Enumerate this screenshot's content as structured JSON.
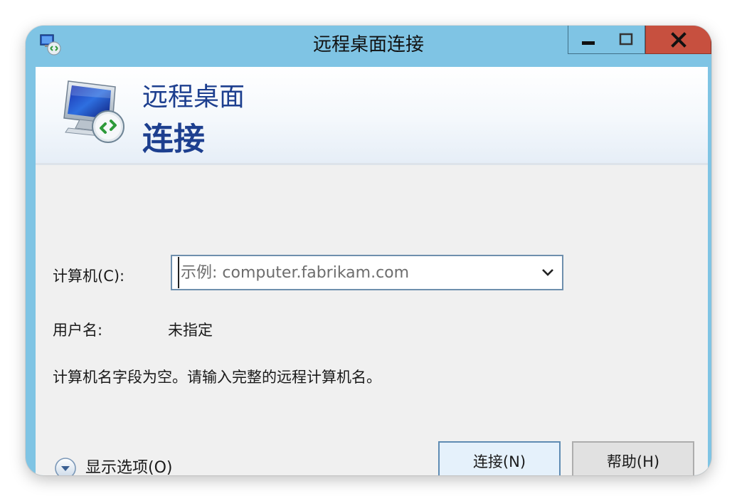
{
  "window": {
    "title": "远程桌面连接",
    "app_icon": "remote-desktop-icon",
    "controls": {
      "minimize_icon": "minimize-icon",
      "maximize_icon": "maximize-icon",
      "close_icon": "close-icon",
      "close_color": "#c7503f"
    },
    "titlebar_color": "#7fc4e4"
  },
  "banner": {
    "line1": "远程桌面",
    "line2": "连接",
    "icon": "remote-desktop-monitor-icon",
    "text_color": "#1d3f8f"
  },
  "form": {
    "computer_label": "计算机(C):",
    "computer_value": "",
    "computer_placeholder": "示例: computer.fabrikam.com",
    "dropdown_icon": "chevron-down-icon",
    "username_label": "用户名:",
    "username_value": "未指定",
    "status_message": "计算机名字段为空。请输入完整的远程计算机名。"
  },
  "footer": {
    "options_icon": "expand-circle-icon",
    "options_label": "显示选项(O)",
    "connect_label": "连接(N)",
    "help_label": "帮助(H)"
  }
}
